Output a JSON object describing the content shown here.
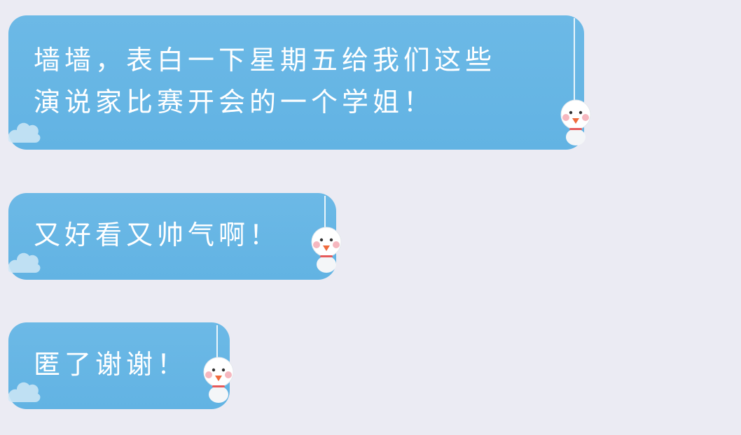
{
  "messages": [
    {
      "lines": [
        "墙墙，表白一下星期五给我们这些",
        "演说家比赛开会的一个学姐！"
      ]
    },
    {
      "lines": [
        "又好看又帅气啊！"
      ]
    },
    {
      "lines": [
        "匿了谢谢！"
      ]
    }
  ],
  "colors": {
    "background": "#ebebf3",
    "bubble": "#66b5e4",
    "text": "#ffffff"
  },
  "icons": [
    "snowman-doll-icon",
    "cloud-icon"
  ]
}
